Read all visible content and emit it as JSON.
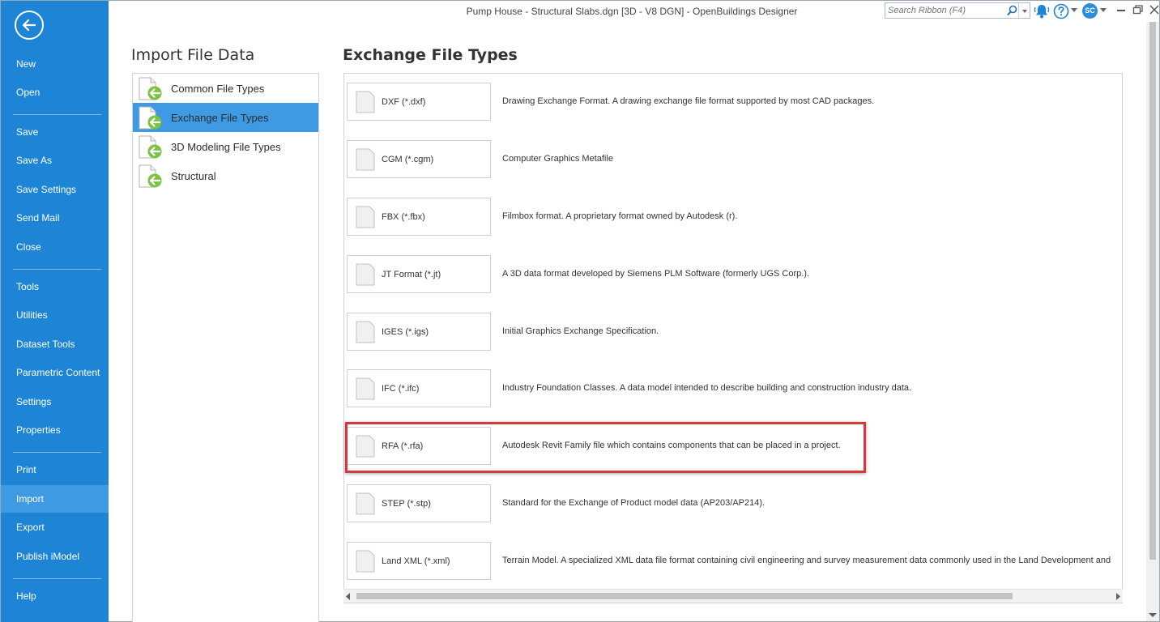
{
  "window": {
    "title": "Pump House - Structural Slabs.dgn [3D - V8 DGN] - OpenBuildings Designer",
    "search_placeholder": "Search Ribbon (F4)",
    "user_initials": "SC"
  },
  "sidebar": {
    "items": [
      {
        "label": "New"
      },
      {
        "label": "Open"
      },
      {
        "label": "Save"
      },
      {
        "label": "Save As"
      },
      {
        "label": "Save Settings"
      },
      {
        "label": "Send Mail"
      },
      {
        "label": "Close"
      },
      {
        "label": "Tools"
      },
      {
        "label": "Utilities"
      },
      {
        "label": "Dataset Tools"
      },
      {
        "label": "Parametric Content"
      },
      {
        "label": "Settings"
      },
      {
        "label": "Properties"
      },
      {
        "label": "Print"
      },
      {
        "label": "Import"
      },
      {
        "label": "Export"
      },
      {
        "label": "Publish iModel"
      },
      {
        "label": "Help"
      }
    ],
    "active": "Import"
  },
  "import_panel": {
    "heading": "Import File Data",
    "categories": [
      {
        "label": "Common File Types"
      },
      {
        "label": "Exchange File Types"
      },
      {
        "label": "3D Modeling File Types"
      },
      {
        "label": "Structural"
      }
    ],
    "selected": "Exchange File Types"
  },
  "exchange_panel": {
    "heading": "Exchange File Types",
    "file_types": [
      {
        "name": "DXF (*.dxf)",
        "description": "Drawing Exchange Format.  A drawing exchange file format supported by most CAD packages."
      },
      {
        "name": "CGM (*.cgm)",
        "description": "Computer Graphics Metafile"
      },
      {
        "name": "FBX (*.fbx)",
        "description": "Filmbox format.  A proprietary format owned by Autodesk (r)."
      },
      {
        "name": "JT Format (*.jt)",
        "description": "A 3D data format developed by Siemens PLM Software (formerly UGS Corp.)."
      },
      {
        "name": "IGES (*.igs)",
        "description": "Initial Graphics Exchange Specification."
      },
      {
        "name": "IFC (*.ifc)",
        "description": "Industry Foundation Classes.  A data model intended to describe building and construction industry data."
      },
      {
        "name": "RFA (*.rfa)",
        "description": "Autodesk Revit Family file which contains components that can be placed in a project."
      },
      {
        "name": "STEP (*.stp)",
        "description": "Standard for the Exchange of Product model data (AP203/AP214)."
      },
      {
        "name": "Land XML (*.xml)",
        "description": "Terrain Model.  A specialized XML data file format containing civil engineering and survey measurement data commonly used in the Land Development and"
      }
    ],
    "highlighted": "RFA (*.rfa)",
    "highlight_color": "#d9383a"
  },
  "colors": {
    "sidebar_bg": "#1d84d6",
    "selection": "#3e9ae2"
  }
}
